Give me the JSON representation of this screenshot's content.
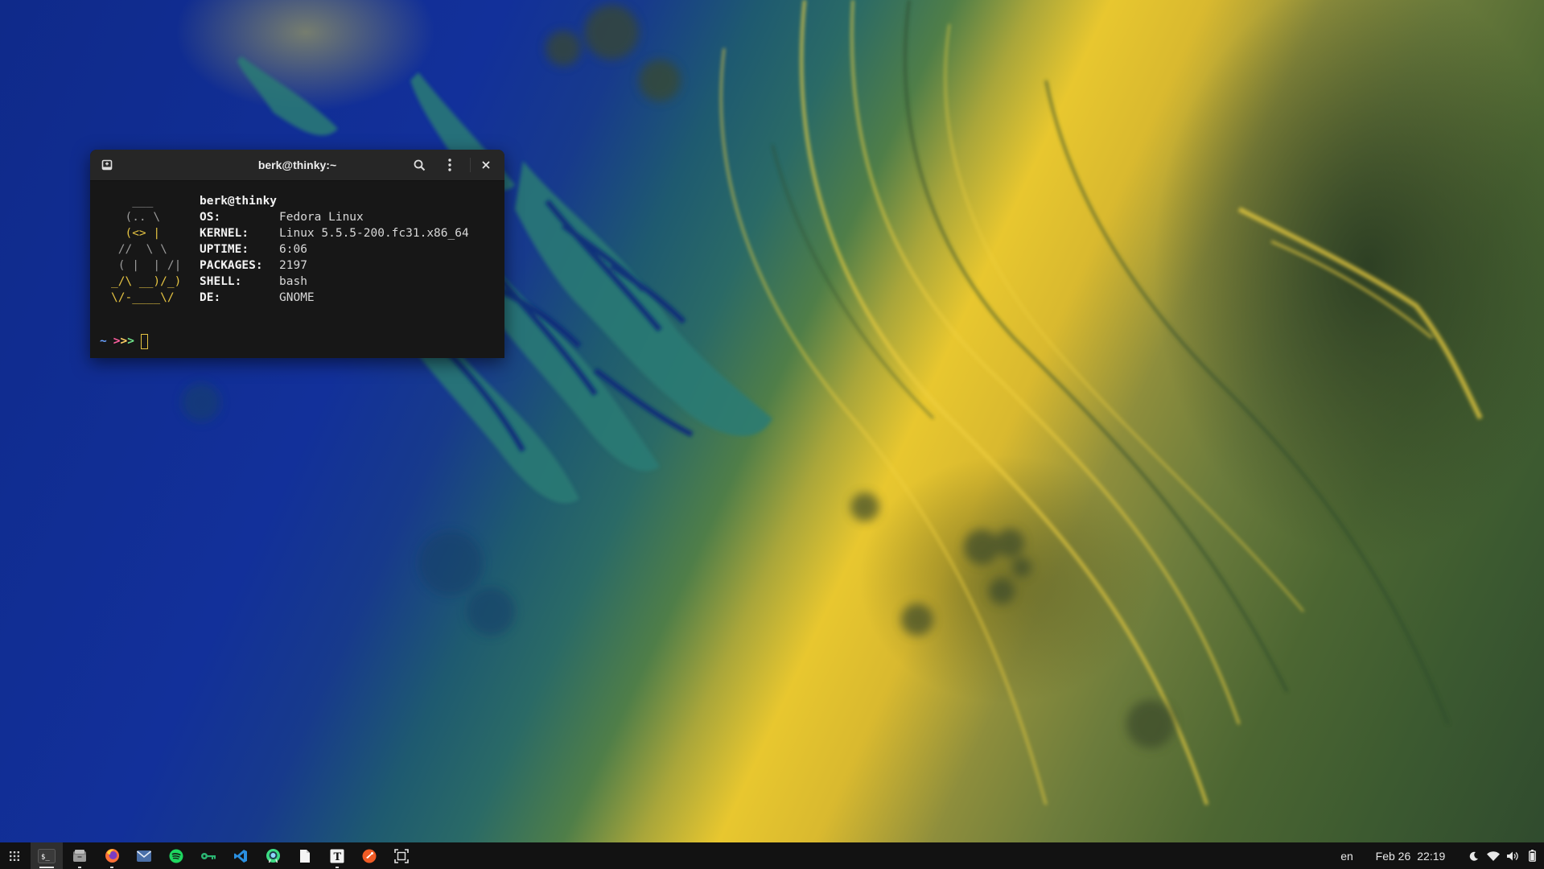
{
  "terminal": {
    "title": "berk@thinky:~",
    "ascii_logo": [
      "   ___",
      "  (.. \\",
      "  (<> |",
      " //  \\ \\",
      " ( |  | /|",
      "_/\\ __)/_)",
      "\\/-____\\/"
    ],
    "host": "berk@thinky",
    "info": [
      {
        "key": "OS:",
        "value": "Fedora Linux"
      },
      {
        "key": "KERNEL:",
        "value": "Linux 5.5.5-200.fc31.x86_64"
      },
      {
        "key": "UPTIME:",
        "value": "6:06"
      },
      {
        "key": "PACKAGES:",
        "value": "2197"
      },
      {
        "key": "SHELL:",
        "value": "bash"
      },
      {
        "key": "DE:",
        "value": "GNOME"
      }
    ],
    "prompt_tilde": "~",
    "prompt_arrows": ">>>"
  },
  "taskbar": {
    "apps": [
      {
        "name": "app-grid-icon",
        "label": "Show Applications"
      },
      {
        "name": "terminal-icon",
        "label": "$_",
        "active": true
      },
      {
        "name": "files-icon",
        "label": "Files"
      },
      {
        "name": "firefox-icon",
        "label": "Firefox"
      },
      {
        "name": "mail-icon",
        "label": "Mail"
      },
      {
        "name": "spotify-icon",
        "label": "Spotify"
      },
      {
        "name": "keys-icon",
        "label": "Passwords"
      },
      {
        "name": "vscode-icon",
        "label": "Visual Studio Code"
      },
      {
        "name": "android-studio-icon",
        "label": "Android Studio"
      },
      {
        "name": "document-icon",
        "label": "Document"
      },
      {
        "name": "typora-icon",
        "label": "T"
      },
      {
        "name": "postman-icon",
        "label": "Postman"
      },
      {
        "name": "screenshot-icon",
        "label": "Screenshot"
      }
    ],
    "keyboard_layout": "en",
    "date": "Feb 26",
    "time": "22:19"
  },
  "colors": {
    "terminal_bg": "#171717",
    "titlebar_bg": "#262626",
    "taskbar_bg": "#121212",
    "accent_yellow": "#e5c342"
  }
}
